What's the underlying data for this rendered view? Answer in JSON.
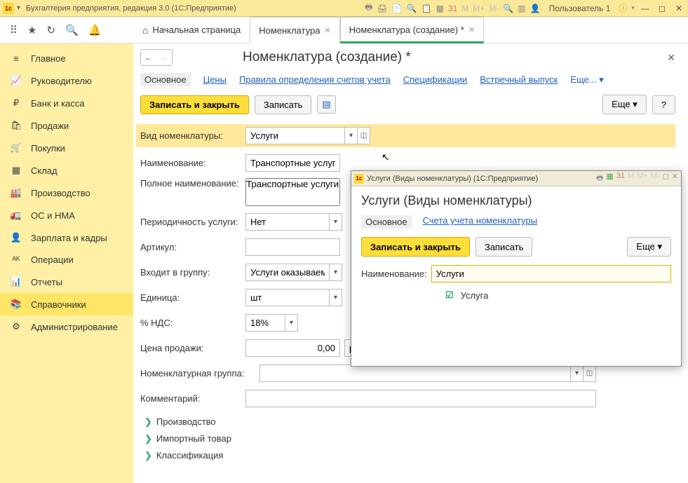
{
  "titlebar": {
    "title": "Бухгалтерия предприятия, редакция 3.0  (1С:Предприятие)",
    "user": "Пользователь 1"
  },
  "tabs": {
    "home": "Начальная страница",
    "t1": "Номенклатура",
    "t2": "Номенклатура (создание) *"
  },
  "sidebar": {
    "items": [
      {
        "icon": "≡",
        "label": "Главное"
      },
      {
        "icon": "📈",
        "label": "Руководителю"
      },
      {
        "icon": "₽",
        "label": "Банк и касса"
      },
      {
        "icon": "🛍",
        "label": "Продажи"
      },
      {
        "icon": "🛒",
        "label": "Покупки"
      },
      {
        "icon": "▦",
        "label": "Склад"
      },
      {
        "icon": "🏭",
        "label": "Производство"
      },
      {
        "icon": "🚛",
        "label": "ОС и НМА"
      },
      {
        "icon": "👤",
        "label": "Зарплата и кадры"
      },
      {
        "icon": "ᴬᴷ",
        "label": "Операции"
      },
      {
        "icon": "📊",
        "label": "Отчеты"
      },
      {
        "icon": "📚",
        "label": "Справочники"
      },
      {
        "icon": "⚙",
        "label": "Администрирование"
      }
    ]
  },
  "page": {
    "title": "Номенклатура (создание) *",
    "links": {
      "l0": "Основное",
      "l1": "Цены",
      "l2": "Правила определения счетов учета",
      "l3": "Спецификации",
      "l4": "Встречный выпуск",
      "more": "Еще..."
    },
    "buttons": {
      "save_close": "Записать и закрыть",
      "save": "Записать",
      "more": "Еще",
      "help": "?"
    },
    "form": {
      "vid_label": "Вид номенклатуры:",
      "vid_value": "Услуги",
      "name_label": "Наименование:",
      "name_value": "Транспортные услуги",
      "full_label": "Полное наименование:",
      "full_value": "Транспортные услуги",
      "period_label": "Периодичность услуги:",
      "period_value": "Нет",
      "artikul_label": "Артикул:",
      "artikul_value": "",
      "group_label": "Входит в группу:",
      "group_value": "Услуги оказываемые",
      "unit_label": "Единица:",
      "unit_value": "шт",
      "nds_label": "% НДС:",
      "nds_value": "18%",
      "price_label": "Цена продажи:",
      "price_value": "0,00",
      "price_cur": "руб.",
      "price_help": "?",
      "nomgrp_label": "Номенклатурная группа:",
      "nomgrp_value": "",
      "comment_label": "Комментарий:",
      "comment_value": "",
      "exp1": "Производство",
      "exp2": "Импортный товар",
      "exp3": "Классификация"
    }
  },
  "modal": {
    "wintitle": "Услуги (Виды номенклатуры)  (1С:Предприятие)",
    "title": "Услуги (Виды номенклатуры)",
    "links": {
      "l0": "Основное",
      "l1": "Счета учета номенклатуры"
    },
    "buttons": {
      "save_close": "Записать и закрыть",
      "save": "Записать",
      "more": "Еще"
    },
    "name_label": "Наименование:",
    "name_value": "Услуги",
    "check_label": "Услуга"
  }
}
